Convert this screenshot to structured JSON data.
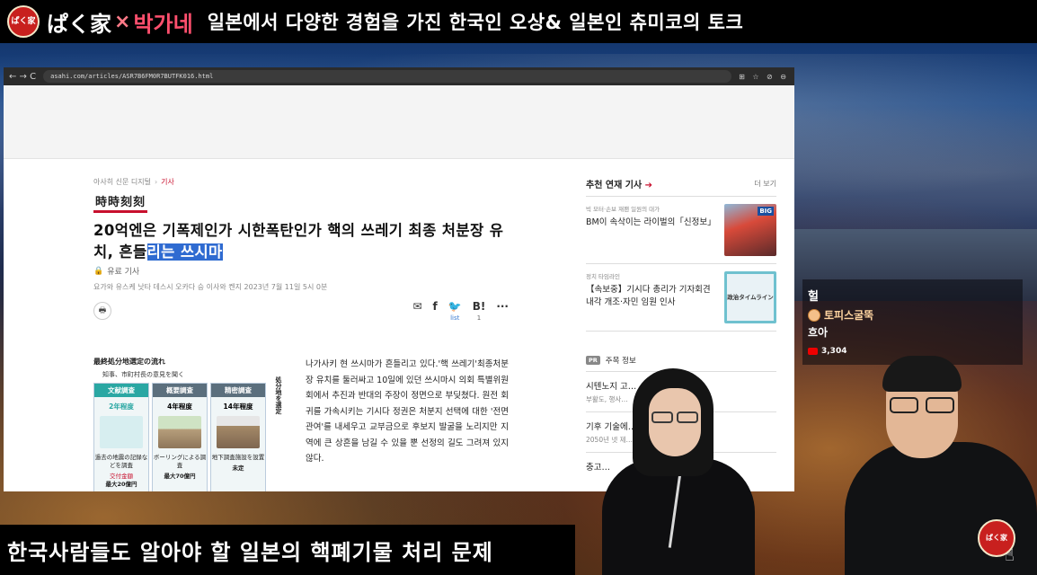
{
  "banner": {
    "logo_text": "ぱく家",
    "brand_part1": "ぱく家",
    "brand_x": "×",
    "brand_part2": "박가네",
    "subtitle": "일본에서 다양한 경험을 가진 한국인 오상& 일본인 츄미코의 토크"
  },
  "browser": {
    "nav_icons": "← → C",
    "url": "asahi.com/articles/ASR7B6FM0R7BUTFK016.html",
    "toolbar_icons": "⊞ ☆ ⊘ ⊖"
  },
  "article": {
    "breadcrumb": [
      "아사히 신문 디지털",
      "기사"
    ],
    "series": "時時刻刻",
    "headline_plain": "20억엔은 기폭제인가 시한폭탄인가 핵의 쓰레기 최종 처분장 유치, 흔들",
    "headline_highlight": "리는 쓰시마",
    "paid_label": "유료 기사",
    "byline": "요가와 유스케 낫타 데스시 오카다 승 이사와 켄지  2023년 7월 11일 5시 0분",
    "share": {
      "mail": "✉",
      "facebook": "f",
      "twitter": "🐦",
      "hatena": "B!",
      "hatena_count": "list",
      "hatena_count2": "1",
      "more": "···",
      "print": "🖶"
    },
    "figure": {
      "title": "最終処分地選定の流れ",
      "note": "知事、市町村長の意見を聞く",
      "side_label": "処分地を選定",
      "columns": [
        {
          "head": "文献調査",
          "years": "2年程度",
          "desc": "過去の地震の記録などを調査",
          "cost_small": "交付金額",
          "cost": "最大20億円",
          "color": "#2aa7a3"
        },
        {
          "head": "概要調査",
          "years": "4年程度",
          "desc": "ボーリングによる調査",
          "cost_small": "",
          "cost": "最大70億円",
          "color": "#5b6f7d"
        },
        {
          "head": "精密調査",
          "years": "14年程度",
          "desc": "地下調査施設を設置",
          "cost_small": "",
          "cost": "未定",
          "color": "#5b6f7d"
        }
      ]
    },
    "body": "나가사키 현 쓰시마가 흔들리고 있다.'핵 쓰레기'최종처분장 유치를 둘러싸고 10일에 있던 쓰시마시 의회 특별위원회에서 추진과 반대의 주장이 정면으로 부딪쳤다. 원전 회귀를 가속시키는 기시다 정권은 처분지 선택에 대한 '전면관여'를 내세우고 교부금으로 후보지 발굴을 노리지만 지역에 큰 상흔을 남길 수 있을 뿐 선정의 길도 그려져 있지 않다."
  },
  "sidebar": {
    "title": "추천 연재 기사",
    "more": "더 보기",
    "items": [
      {
        "kicker": "빅 모터·손보 재팬 일원의 대가",
        "headline": "BM이 속삭이는 라이벌의「신정보」",
        "thumb_label": "BIG"
      },
      {
        "kicker": "정치 타임라인",
        "headline": "【속보중】기시다 총리가 기자회견 내각 개조·자민 임원 인사",
        "thumb_label": "政治タイムライン"
      }
    ],
    "pr_badge": "PR",
    "pr_label": "주목 정보",
    "pr_items": [
      {
        "title": "시텐노지 고…                  …는 힘」",
        "sub": "부활도, 행사…"
      },
      {
        "title": "기후 기술에…               …들어지는 미래",
        "sub": "2050년 넷 제…"
      },
      {
        "title": "충고…",
        "sub": ""
      }
    ]
  },
  "chat": {
    "line1": "헐",
    "user": "토피스굴뚝",
    "message": "흐아",
    "count": "3,304"
  },
  "caption": "한국사람들도 알아야 할 일본의 핵폐기물 처리 문제",
  "corner_logo": "ぱく家"
}
